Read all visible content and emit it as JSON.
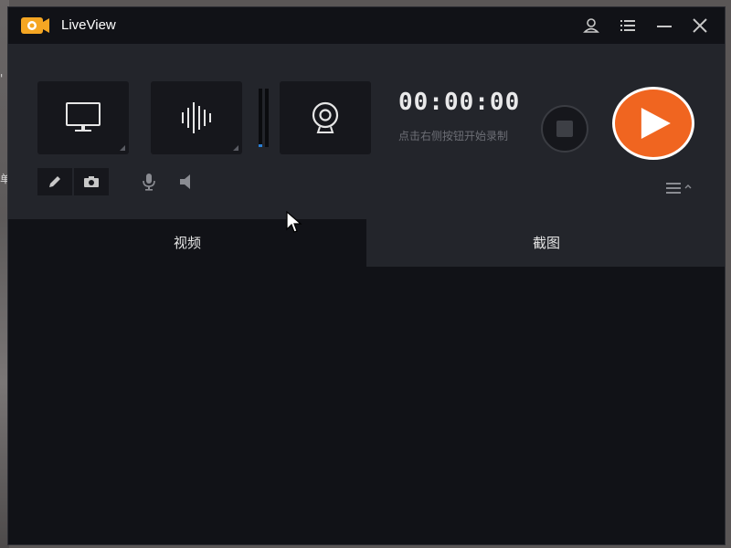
{
  "app": {
    "title": "LiveView",
    "accent_color": "#f06520"
  },
  "titlebar": {
    "buttons": [
      {
        "name": "user-icon"
      },
      {
        "name": "list-icon"
      },
      {
        "name": "minimize-icon"
      },
      {
        "name": "close-icon"
      }
    ]
  },
  "recorder": {
    "sources": [
      {
        "name": "screen",
        "icon": "monitor-icon"
      },
      {
        "name": "audio",
        "icon": "audio-wave-icon"
      },
      {
        "name": "webcam",
        "icon": "webcam-icon"
      }
    ],
    "timer": "00:00:00",
    "hint": "点击右侧按钮开始录制",
    "audio_level": 0.05,
    "tools": [
      {
        "icon": "pencil-icon"
      },
      {
        "icon": "camera-icon"
      },
      {
        "icon": "microphone-icon"
      },
      {
        "icon": "speaker-icon"
      }
    ]
  },
  "tabs": [
    {
      "label": "视频",
      "active": true
    },
    {
      "label": "截图",
      "active": false
    }
  ]
}
